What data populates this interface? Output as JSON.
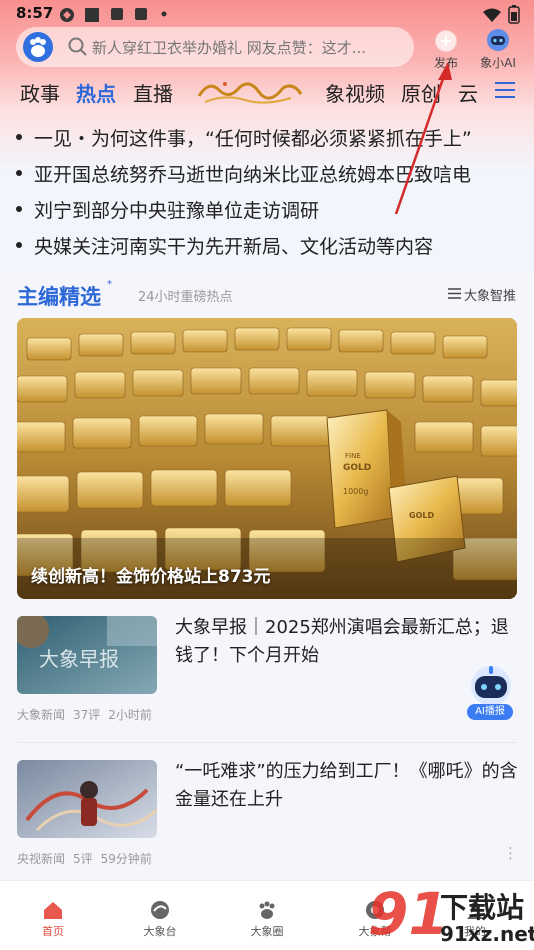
{
  "status_bar": {
    "time": "8:57"
  },
  "search": {
    "placeholder": "新人穿红卫衣举办婚礼  网友点赞：这才..."
  },
  "header_actions": {
    "publish_label": "发布",
    "ai_label": "象小AI"
  },
  "tabs": [
    "政事",
    "热点",
    "直播",
    "象视频",
    "原创",
    "云"
  ],
  "tabs_active_index": 1,
  "headlines": [
    "一见・为何这件事，“任何时候都必须紧紧抓在手上”",
    "亚开国总统努乔马逝世向纳米比亚总统姆本巴致唁电",
    "刘宁到部分中央驻豫单位走访调研",
    "央媒关注河南实干为先开新局、文化活动等内容"
  ],
  "section": {
    "title": "主编精选",
    "star": "*",
    "subtitle": "24小时重磅热点",
    "right_label": "大象智推"
  },
  "hero": {
    "caption": "续创新高！金饰价格站上873元"
  },
  "news": [
    {
      "title": "大象早报｜2025郑州演唱会最新汇总；退钱了！下个月开始",
      "thumb_text": "大象早报",
      "source": "大象新闻",
      "comments": "37评",
      "time": "2小时前"
    },
    {
      "title": "“一吒难求”的压力给到工厂！《哪吒》的含金量还在上升",
      "source": "央视新闻",
      "comments": "5评",
      "time": "59分钟前"
    }
  ],
  "ai_float_label": "AI播报",
  "bottom_nav": [
    {
      "label": "首页",
      "active": true
    },
    {
      "label": "大象台",
      "active": false
    },
    {
      "label": "大象圈",
      "active": false
    },
    {
      "label": "大象帮",
      "active": false
    },
    {
      "label": "我的",
      "active": false
    }
  ],
  "watermark": {
    "cn": "下载站",
    "url": "91xz.net",
    "num": "91"
  },
  "colors": {
    "accent": "#2d67d8",
    "active_nav": "#e14a3f",
    "header_gradient_top": "#f88f8f"
  }
}
